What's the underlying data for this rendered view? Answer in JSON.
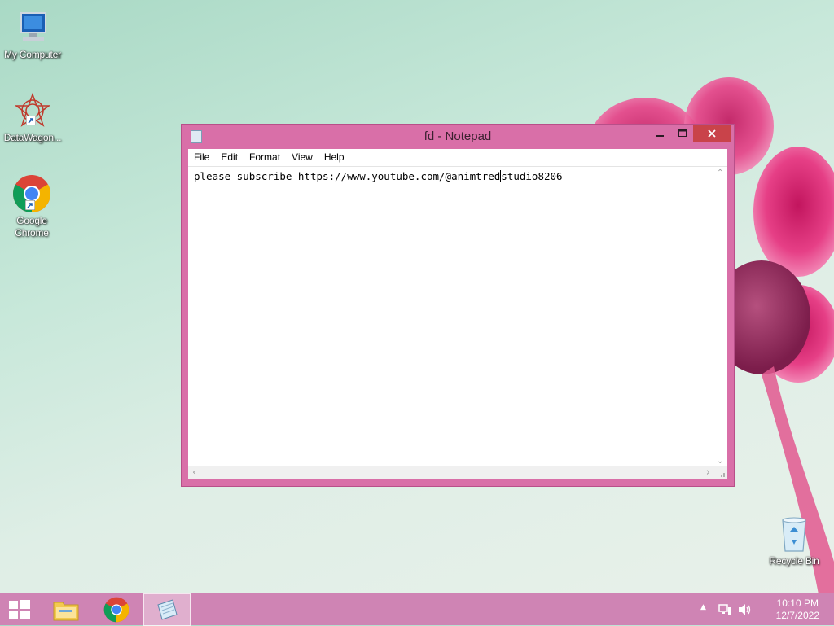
{
  "desktop": {
    "icons": [
      {
        "label": "My Computer",
        "icon": "computer-icon"
      },
      {
        "label": "DataWagon...",
        "icon": "datawagon-icon"
      },
      {
        "label": "Google Chrome",
        "icon": "chrome-icon"
      },
      {
        "label": "Recycle Bin",
        "icon": "recycle-bin-icon"
      }
    ]
  },
  "notepad": {
    "title": "fd - Notepad",
    "menu": [
      "File",
      "Edit",
      "Format",
      "View",
      "Help"
    ],
    "content_before_caret": "please subscribe https://www.youtube.com/@animtred",
    "content_after_caret": "studio8206",
    "accent_color": "#d96fa8",
    "close_color": "#c9434a"
  },
  "taskbar": {
    "items": [
      "start-icon",
      "file-explorer-icon",
      "chrome-icon",
      "notepad-icon"
    ],
    "active_item": "notepad-icon",
    "tray_icons": [
      "show-hidden-icons-chevron",
      "network-icon",
      "volume-icon"
    ],
    "time": "10:10 PM",
    "date": "12/7/2022",
    "color": "#cf84b4"
  }
}
